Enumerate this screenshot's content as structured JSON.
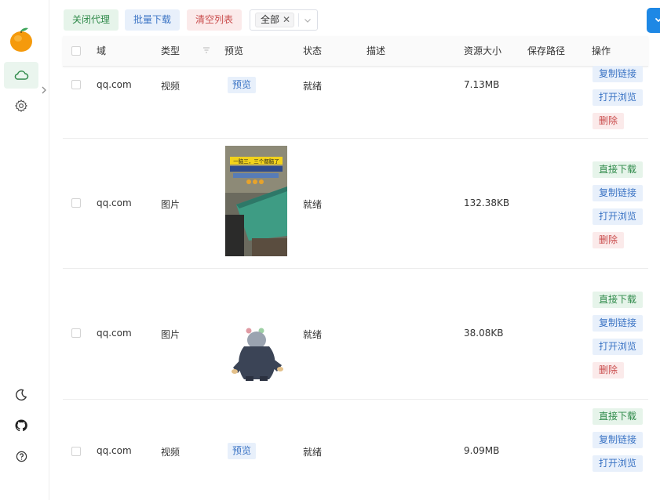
{
  "toolbar": {
    "close_proxy": "关闭代理",
    "batch_download": "批量下载",
    "clear_list": "清空列表",
    "filter_tag": "全部"
  },
  "table": {
    "headers": {
      "domain": "域",
      "type": "类型",
      "preview": "预览",
      "status": "状态",
      "description": "描述",
      "size": "资源大小",
      "save_path": "保存路径",
      "actions": "操作"
    },
    "actions": {
      "download": "直接下载",
      "copy": "复制链接",
      "open": "打开浏览",
      "delete": "删除"
    },
    "rows": [
      {
        "domain": "qq.com",
        "type": "视频",
        "preview": "预览",
        "status": "就绪",
        "size": "7.13MB"
      },
      {
        "domain": "qq.com",
        "type": "图片",
        "status": "就绪",
        "size": "132.38KB",
        "thumb_caption": "一脑三，三个都脑了"
      },
      {
        "domain": "qq.com",
        "type": "图片",
        "status": "就绪",
        "size": "38.08KB"
      },
      {
        "domain": "qq.com",
        "type": "视频",
        "preview": "预览",
        "status": "就绪",
        "size": "9.09MB"
      }
    ]
  },
  "colors": {
    "accent_green": "#2f8a4a",
    "accent_blue": "#3a73c4",
    "accent_red": "#c94b4b",
    "top_right_button": "#1e88e5"
  },
  "icons": {
    "logo": "orange-logo-icon",
    "cloud": "cloud-icon",
    "settings": "gear-icon",
    "theme": "moon-icon",
    "github": "github-icon",
    "help": "help-circle-icon",
    "download_app": "download-icon"
  }
}
